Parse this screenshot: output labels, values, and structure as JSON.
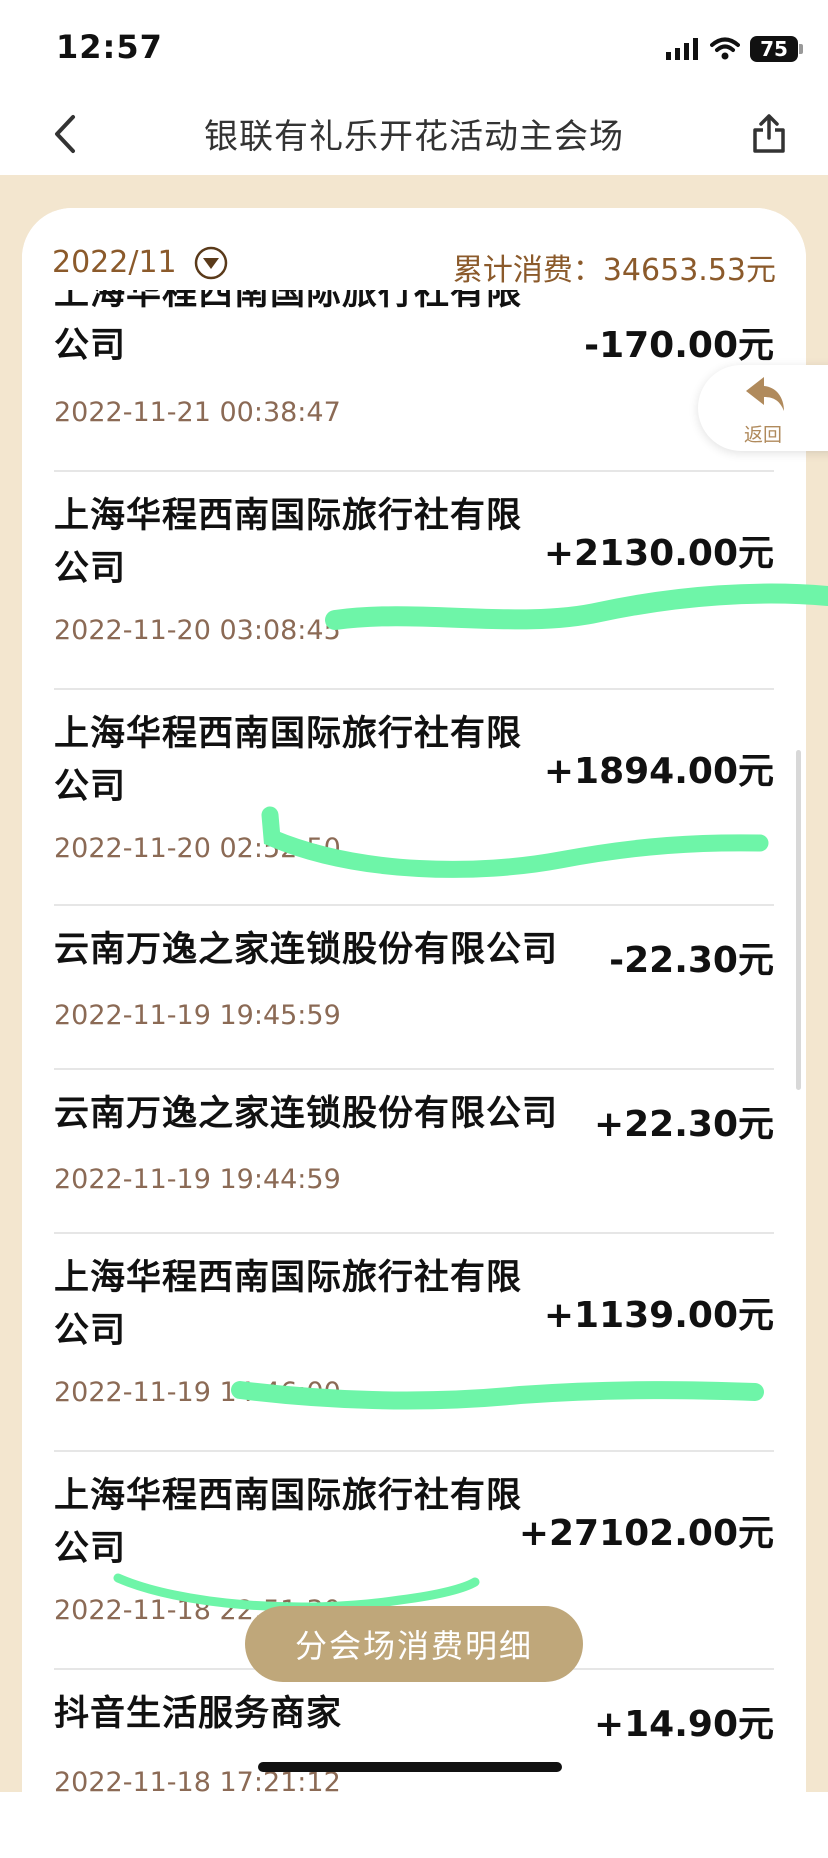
{
  "status_bar": {
    "time": "12:57",
    "battery": "75"
  },
  "nav": {
    "title": "银联有礼乐开花活动主会场"
  },
  "summary": {
    "month": "2022/11",
    "total": "累计消费：34653.53元"
  },
  "transactions": [
    {
      "merchant": "上海华程西南国际旅行社有限公司",
      "amount": "-170.00元",
      "time": "2022-11-21 00:38:47"
    },
    {
      "merchant": "上海华程西南国际旅行社有限公司",
      "amount": "+2130.00元",
      "time": "2022-11-20 03:08:45"
    },
    {
      "merchant": "上海华程西南国际旅行社有限公司",
      "amount": "+1894.00元",
      "time": "2022-11-20 02:52:50"
    },
    {
      "merchant": "云南万逸之家连锁股份有限公司",
      "amount": "-22.30元",
      "time": "2022-11-19 19:45:59"
    },
    {
      "merchant": "云南万逸之家连锁股份有限公司",
      "amount": "+22.30元",
      "time": "2022-11-19 19:44:59"
    },
    {
      "merchant": "上海华程西南国际旅行社有限公司",
      "amount": "+1139.00元",
      "time": "2022-11-19 14:46:00"
    },
    {
      "merchant": "上海华程西南国际旅行社有限公司",
      "amount": "+27102.00元",
      "time": "2022-11-18 22:51:30"
    },
    {
      "merchant": "抖音生活服务商家",
      "amount": "+14.90元",
      "time": "2022-11-18 17:21:12"
    }
  ],
  "float_back": {
    "label": "返回"
  },
  "bottom_button": {
    "label": "分会场消费明细"
  },
  "colors": {
    "accent": "#8b5a2b",
    "background": "#f3e6cf",
    "button": "#bfa77a",
    "highlighter": "#6ef5a8"
  }
}
